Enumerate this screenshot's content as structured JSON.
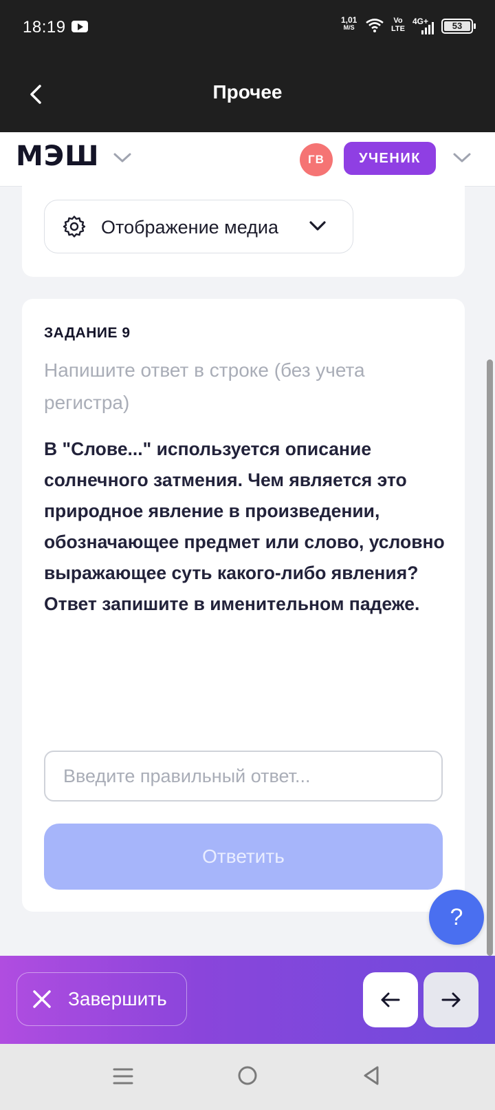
{
  "status_bar": {
    "time": "18:19",
    "speed_value": "1,01",
    "speed_unit": "M/S",
    "volte_top": "Vo",
    "volte_bottom": "LTE",
    "network": "4G+",
    "battery": "53"
  },
  "header": {
    "title": "Прочее"
  },
  "mesh_bar": {
    "logo": "МЭШ",
    "avatar_initials": "ГВ",
    "role": "УЧЕНИК"
  },
  "media": {
    "label": "Отображение медиа"
  },
  "task": {
    "number": "ЗАДАНИЕ 9",
    "hint": "Напишите ответ в строке (без учета регистра)",
    "text": "В \"Слове...\" используется описание солнечного затмения. Чем является это природное явление в произведении, обозначающее предмет или слово, условно выражающее суть какого-либо явления? Ответ запишите в именительном падеже.",
    "input_placeholder": "Введите правильный ответ...",
    "input_value": "",
    "submit_label": "Ответить"
  },
  "help": {
    "label": "?"
  },
  "bottom_bar": {
    "finish_label": "Завершить"
  },
  "colors": {
    "dark_header": "#1f1f1f",
    "avatar": "#f57474",
    "role_badge": "#8f3fe3",
    "submit_disabled": "#a6b5fa",
    "help_button": "#4a6ff0",
    "bottom_gradient_start": "#b04de0",
    "bottom_gradient_end": "#6f4bdc"
  },
  "icons": {
    "back": "chevron-left-icon",
    "gear": "gear-icon",
    "dropdown": "chevron-down-icon",
    "close": "close-icon",
    "prev": "arrow-left-icon",
    "next": "arrow-right-icon"
  }
}
